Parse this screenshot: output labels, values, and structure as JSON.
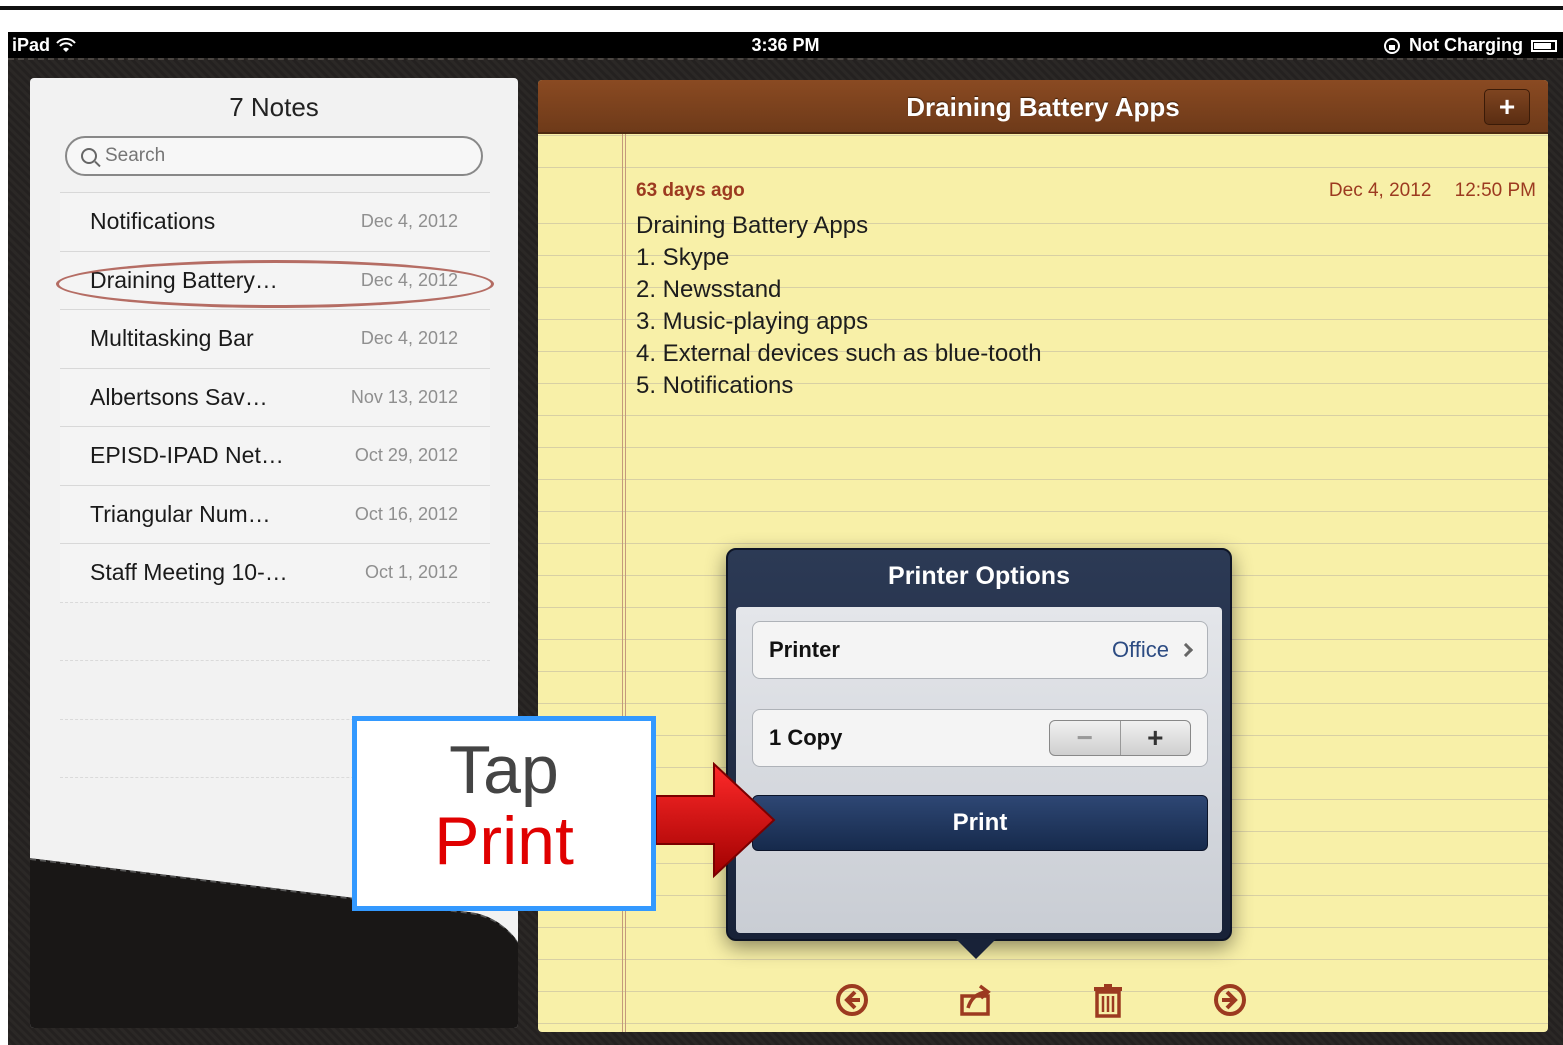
{
  "status_bar": {
    "device": "iPad",
    "time": "3:36 PM",
    "charge": "Not Charging"
  },
  "notes_list": {
    "title": "7 Notes",
    "search_placeholder": "Search",
    "items": [
      {
        "title": "Notifications",
        "date": "Dec 4, 2012"
      },
      {
        "title": "Draining Battery…",
        "date": "Dec 4, 2012"
      },
      {
        "title": "Multitasking Bar",
        "date": "Dec 4, 2012"
      },
      {
        "title": "Albertsons Sav…",
        "date": "Nov 13, 2012"
      },
      {
        "title": "EPISD-IPAD Net…",
        "date": "Oct 29, 2012"
      },
      {
        "title": "Triangular Num…",
        "date": "Oct 16, 2012"
      },
      {
        "title": "Staff Meeting 10-…",
        "date": "Oct 1, 2012"
      }
    ]
  },
  "note": {
    "header_title": "Draining Battery Apps",
    "add_label": "+",
    "age": "63 days ago",
    "date": "Dec 4, 2012",
    "time": "12:50 PM",
    "lines": [
      "Draining Battery Apps",
      "1.  Skype",
      "2.  Newsstand",
      "3.  Music-playing apps",
      "4.  External devices such as blue-tooth",
      "5.  Notifications"
    ]
  },
  "printer_options": {
    "title": "Printer Options",
    "printer_label": "Printer",
    "printer_value": "Office",
    "copies_label": "1 Copy",
    "minus_label": "−",
    "plus_label": "+",
    "print_label": "Print"
  },
  "callout": {
    "line1": "Tap",
    "line2": "Print"
  },
  "colors": {
    "note_accent": "#9c3a20",
    "callout_border": "#3399ff",
    "callout_emphasis": "#e00000",
    "print_button": "#162a4c"
  }
}
